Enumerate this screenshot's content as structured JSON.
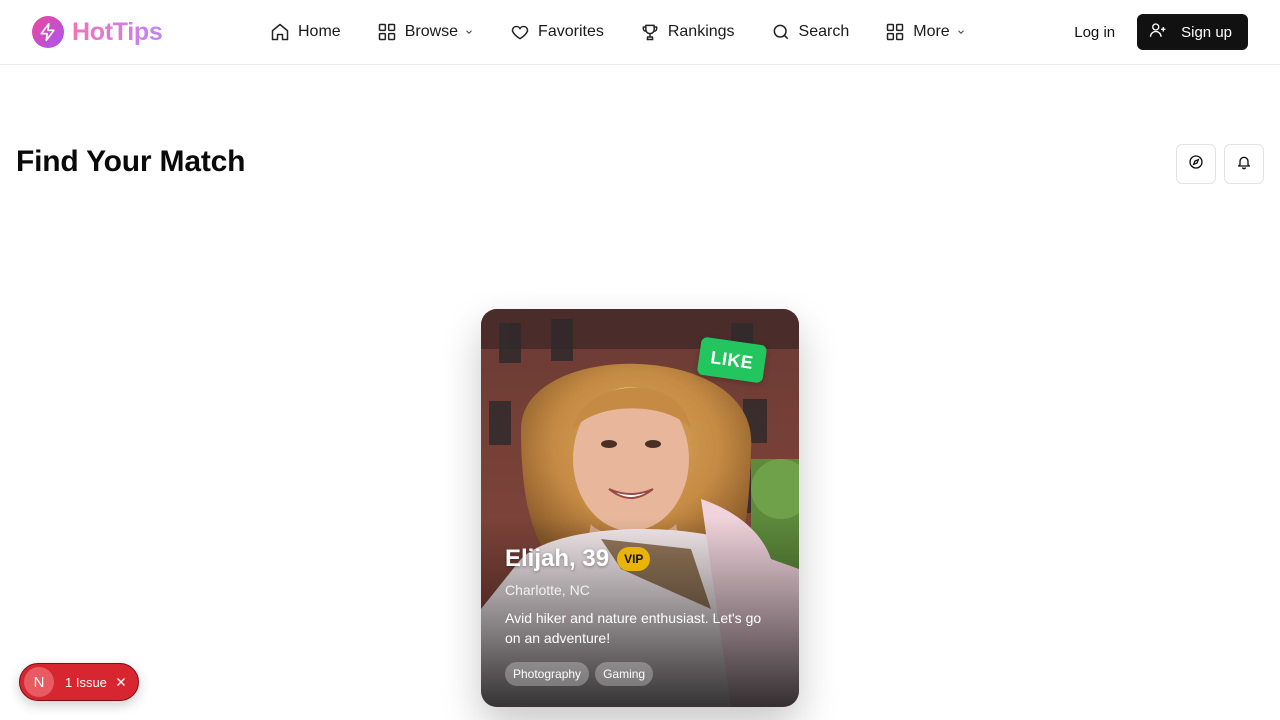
{
  "header": {
    "logo_text": "HotTips",
    "nav": [
      {
        "label": "Home",
        "icon": "home-icon",
        "dropdown": false
      },
      {
        "label": "Browse",
        "icon": "grid-icon",
        "dropdown": true
      },
      {
        "label": "Favorites",
        "icon": "heart-icon",
        "dropdown": false
      },
      {
        "label": "Rankings",
        "icon": "trophy-icon",
        "dropdown": false
      },
      {
        "label": "Search",
        "icon": "search-icon",
        "dropdown": false
      },
      {
        "label": "More",
        "icon": "grid-icon",
        "dropdown": true
      }
    ],
    "login_label": "Log in",
    "signup_label": "Sign up"
  },
  "page": {
    "title": "Find Your Match",
    "actions": [
      {
        "name": "compass",
        "icon": "compass-icon"
      },
      {
        "name": "notifications",
        "icon": "bell-icon"
      }
    ]
  },
  "card": {
    "stamp": "LIKE",
    "name_age": "Elijah, 39",
    "badge": "VIP",
    "location": "Charlotte, NC",
    "bio": "Avid hiker and nature enthusiast. Let's go on an adventure!",
    "tags": [
      "Photography",
      "Gaming"
    ]
  },
  "issue_badge": {
    "logo_letter": "N",
    "label": "1 Issue"
  },
  "colors": {
    "brand_gradient_start": "#ec4899",
    "brand_gradient_end": "#a855f7",
    "like": "#22c55e",
    "vip": "#eab308",
    "issue": "#d7262f"
  }
}
